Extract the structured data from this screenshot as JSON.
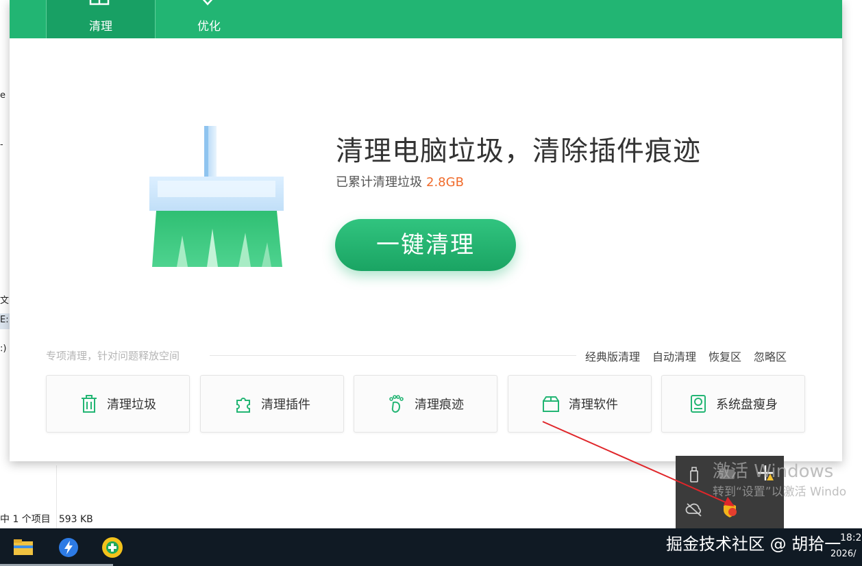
{
  "background": {
    "left_fragments": [
      "e",
      "-",
      "文 (",
      "E:",
      ":)"
    ],
    "status": {
      "selected": "中 1 个项目",
      "size": "593 KB"
    }
  },
  "tabs": [
    {
      "label": "清理",
      "active": true
    },
    {
      "label": "优化",
      "active": false
    }
  ],
  "hero": {
    "headline": "清理电脑垃圾，清除插件痕迹",
    "sub_label": "已累计清理垃圾",
    "sub_value": "2.8GB",
    "button": "一键清理"
  },
  "section": {
    "caption": "专项清理，针对问题释放空间",
    "links": [
      "经典版清理",
      "自动清理",
      "恢复区",
      "忽略区"
    ]
  },
  "cards": [
    {
      "label": "清理垃圾",
      "icon": "trash-icon"
    },
    {
      "label": "清理插件",
      "icon": "puzzle-icon"
    },
    {
      "label": "清理痕迹",
      "icon": "footprint-icon"
    },
    {
      "label": "清理软件",
      "icon": "box-icon"
    },
    {
      "label": "系统盘瘦身",
      "icon": "disk-icon"
    }
  ],
  "activation": {
    "title": "激活 Windows",
    "subtitle": "转到“设置”以激活 Windo"
  },
  "taskbar": {
    "watermark": "掘金技术社区 @ 胡拾一",
    "time": "18:2",
    "date": "2026/"
  },
  "colors": {
    "brand": "#22b573",
    "accent_number": "#f06b2b"
  }
}
